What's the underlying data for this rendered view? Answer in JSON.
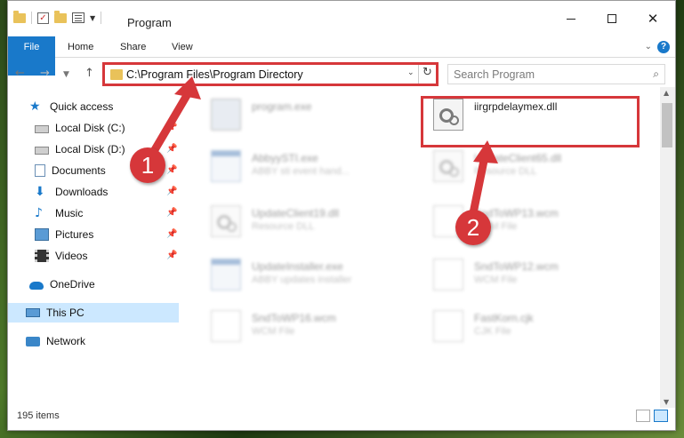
{
  "window": {
    "title": "Program",
    "controls": {
      "minimize": "minimize",
      "maximize": "maximize",
      "close": "✕"
    }
  },
  "ribbon": {
    "tabs": [
      {
        "label": "File"
      },
      {
        "label": "Home"
      },
      {
        "label": "Share"
      },
      {
        "label": "View"
      }
    ],
    "help": "?"
  },
  "address": {
    "path": "C:\\Program Files\\Program Directory"
  },
  "search": {
    "placeholder": "Search Program"
  },
  "sidebar": {
    "items": [
      {
        "label": "Quick access",
        "icon": "star-icon",
        "pinned": false
      },
      {
        "label": "Local Disk (C:)",
        "icon": "disk-icon",
        "pinned": true
      },
      {
        "label": "Local Disk (D:)",
        "icon": "disk-icon",
        "pinned": true
      },
      {
        "label": "Documents",
        "icon": "documents-icon",
        "pinned": true
      },
      {
        "label": "Downloads",
        "icon": "download-icon",
        "pinned": true
      },
      {
        "label": "Music",
        "icon": "music-icon",
        "pinned": true
      },
      {
        "label": "Pictures",
        "icon": "pictures-icon",
        "pinned": true
      },
      {
        "label": "Videos",
        "icon": "videos-icon",
        "pinned": true
      },
      {
        "label": "OneDrive",
        "icon": "onedrive-icon",
        "pinned": false
      },
      {
        "label": "This PC",
        "icon": "this-pc-icon",
        "pinned": false,
        "selected": true
      },
      {
        "label": "Network",
        "icon": "network-icon",
        "pinned": false
      }
    ]
  },
  "files": [
    {
      "name": "program.exe",
      "type": "",
      "icon": "exe-icon",
      "blurred": true
    },
    {
      "name": "iirgrpdelaymex.dll",
      "type": "",
      "icon": "dll-gear-icon",
      "blurred": false
    },
    {
      "name": "AbbyySTI.exe",
      "type": "ABBY sti event hand...",
      "icon": "app-icon",
      "blurred": true
    },
    {
      "name": "UpdateClient65.dll",
      "type": "Resource DLL",
      "icon": "dll-gear-icon",
      "blurred": true
    },
    {
      "name": "UpdateClient19.dll",
      "type": "Resource DLL",
      "icon": "dll-gear-icon",
      "blurred": true
    },
    {
      "name": "SndToWP13.wcm",
      "type": "WCM File",
      "icon": "file-icon",
      "blurred": true
    },
    {
      "name": "UpdateInstaller.exe",
      "type": "ABBY updates installer",
      "icon": "app-icon",
      "blurred": true
    },
    {
      "name": "SndToWP12.wcm",
      "type": "WCM File",
      "icon": "file-icon",
      "blurred": true
    },
    {
      "name": "SndToWP16.wcm",
      "type": "WCM File",
      "icon": "file-icon",
      "blurred": true
    },
    {
      "name": "FastKorn.cjk",
      "type": "CJK File",
      "icon": "file-icon",
      "blurred": true
    }
  ],
  "status": {
    "count": "195 items"
  },
  "annotations": {
    "badge1": "1",
    "badge2": "2",
    "color": "#d6373a"
  },
  "colors": {
    "accent": "#1979ca",
    "selection": "#cce8ff"
  }
}
